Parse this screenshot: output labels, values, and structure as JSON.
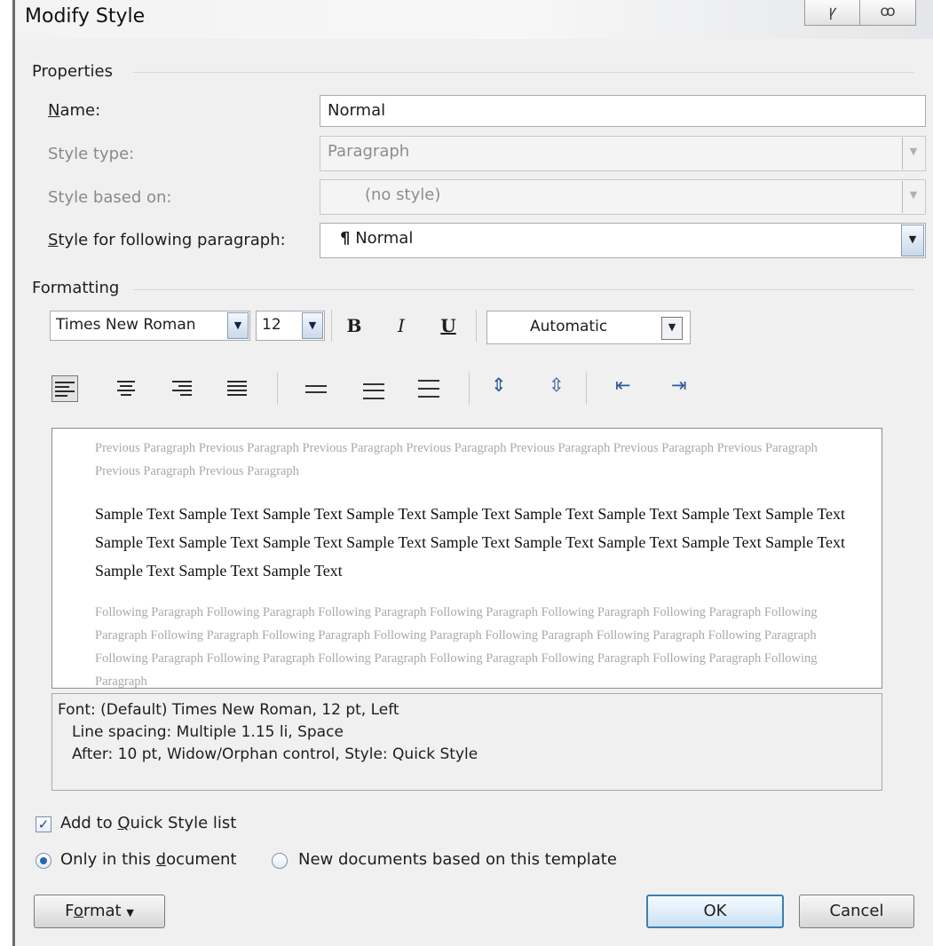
{
  "window": {
    "title": "Modify Style",
    "title_buttons": [
      "ꝩ",
      "ꝏ"
    ]
  },
  "properties": {
    "heading": "Properties",
    "name": {
      "label": "Name:",
      "value": "Normal"
    },
    "style_type": {
      "label": "Style type:",
      "value": "Paragraph"
    },
    "style_based_on": {
      "label": "Style based on:",
      "value": "(no style)"
    },
    "style_following": {
      "label": "Style for following paragraph:",
      "value": "Normal",
      "glyph": "¶"
    }
  },
  "formatting": {
    "heading": "Formatting",
    "font_name": "Times New Roman",
    "font_size": "12",
    "bold": "B",
    "italic": "I",
    "underline": "U",
    "color": "Automatic"
  },
  "preview": {
    "previous": "Previous Paragraph Previous Paragraph Previous Paragraph Previous Paragraph Previous Paragraph Previous Paragraph Previous Paragraph Previous Paragraph Previous Paragraph",
    "sample": "Sample Text Sample Text Sample Text Sample Text Sample Text Sample Text Sample Text Sample Text Sample Text Sample Text Sample Text Sample Text Sample Text Sample Text Sample Text Sample Text Sample Text Sample Text Sample Text Sample Text Sample Text",
    "following": "Following Paragraph Following Paragraph Following Paragraph Following Paragraph Following Paragraph Following Paragraph Following Paragraph Following Paragraph Following Paragraph Following Paragraph Following Paragraph Following Paragraph Following Paragraph Following Paragraph Following Paragraph Following Paragraph Following Paragraph Following Paragraph Following Paragraph Following Paragraph"
  },
  "description": {
    "line1": "Font: (Default) Times New Roman, 12 pt, Left",
    "line2": "Line spacing:  Multiple 1.15 li, Space",
    "line3": "After:  10 pt, Widow/Orphan control, Style: Quick Style"
  },
  "options": {
    "add_quick_style": "Add to Quick Style list",
    "add_quick_style_checked": true,
    "only_this_document": "Only in this document",
    "new_documents": "New documents based on this template"
  },
  "buttons": {
    "format": "Format",
    "ok": "OK",
    "cancel": "Cancel"
  }
}
